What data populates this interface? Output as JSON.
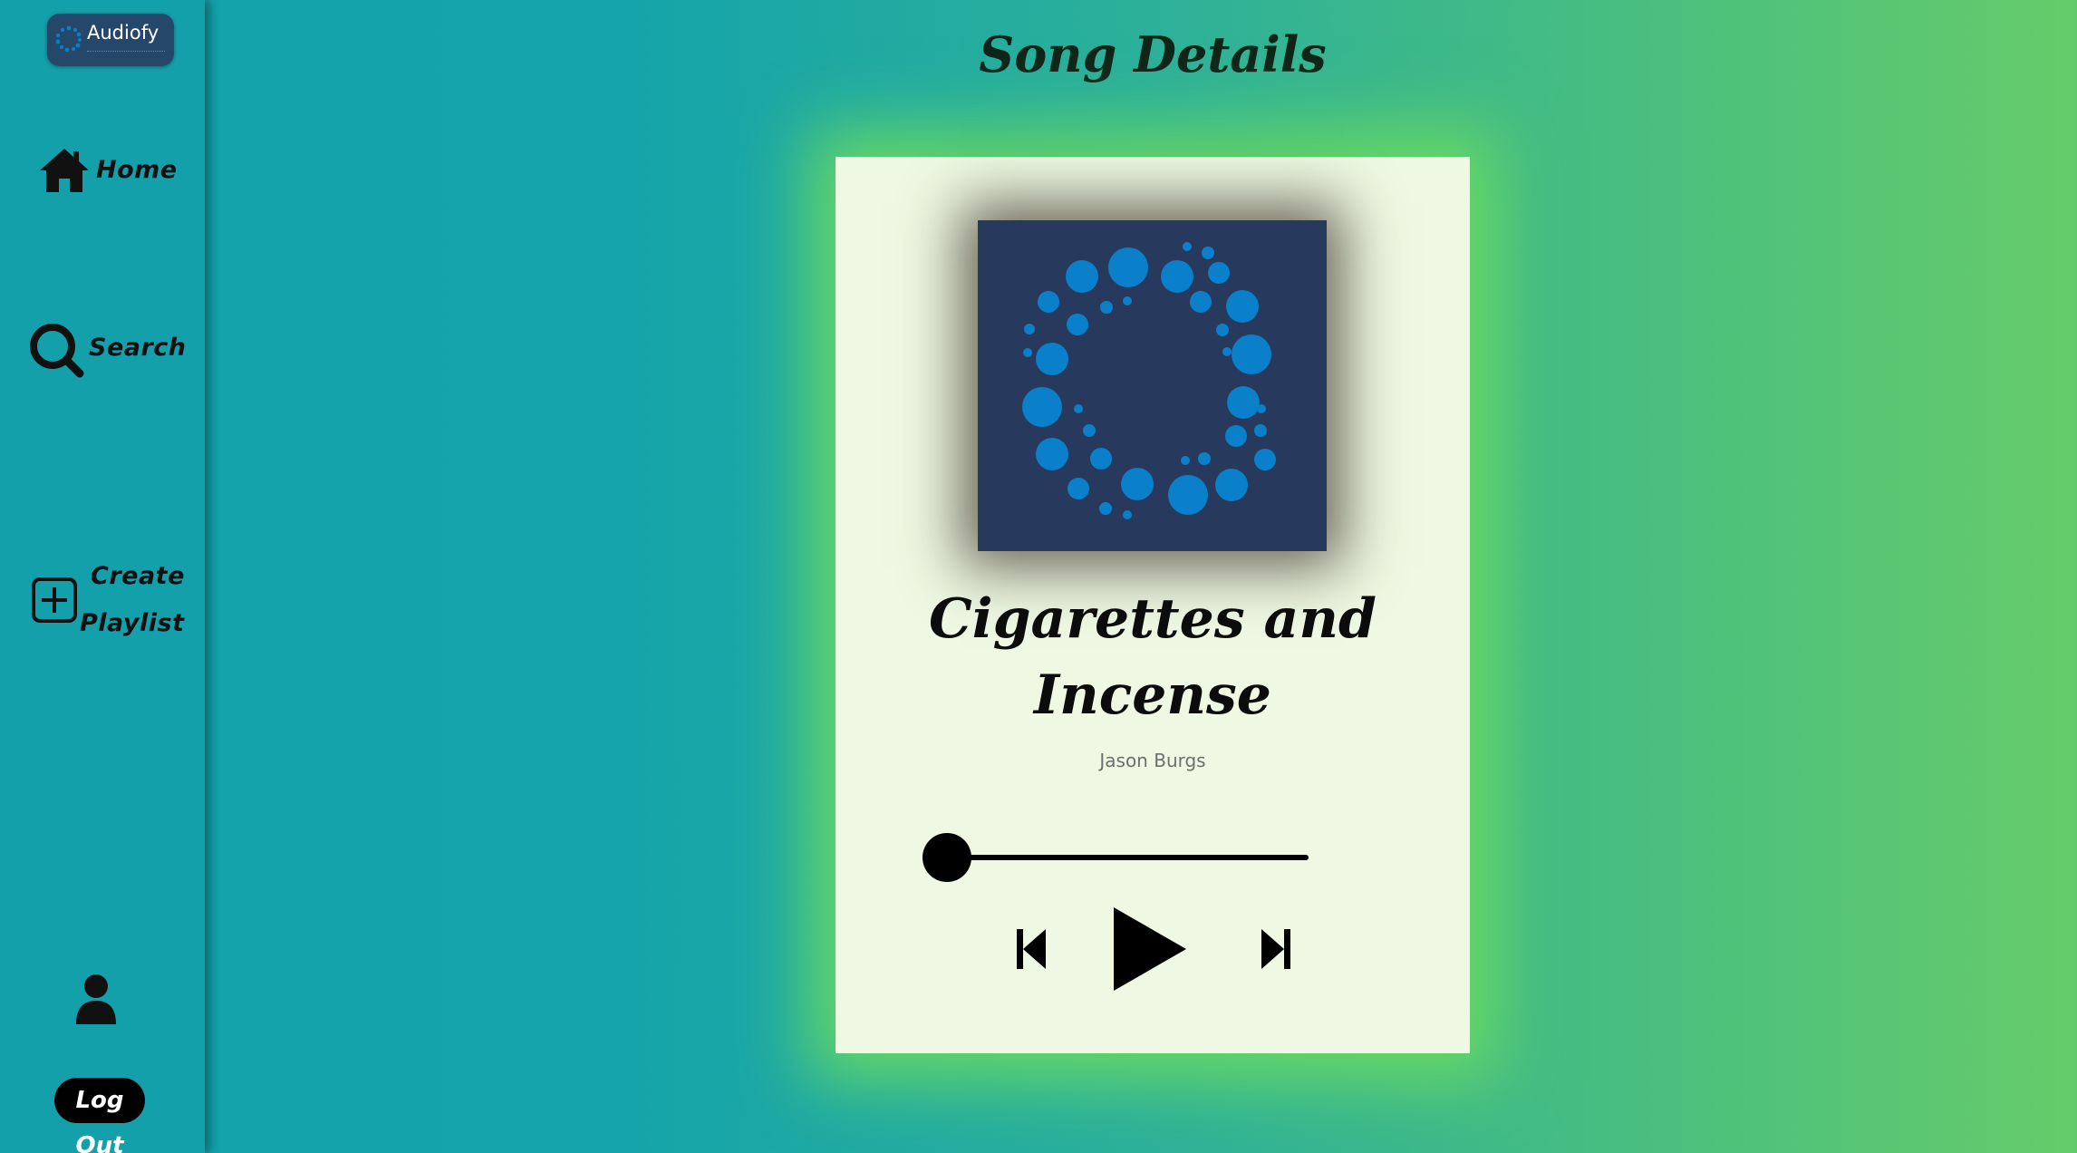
{
  "app": {
    "name": "Audiofy"
  },
  "sidebar": {
    "items": [
      {
        "label": "Home",
        "icon": "home-icon"
      },
      {
        "label": "Search",
        "icon": "search-icon"
      },
      {
        "label_line1": "Create",
        "label_line2": "Playlist",
        "icon": "plus-square-icon"
      }
    ],
    "profile_icon": "user-icon",
    "logout_label": "Log Out"
  },
  "main": {
    "title": "Song Details"
  },
  "song": {
    "title_line1": "Cigarettes and",
    "title_line2": "Incense",
    "artist": "Jason Burgs",
    "progress": 0.0
  },
  "player": {
    "prev_icon": "skip-previous-icon",
    "play_icon": "play-icon",
    "next_icon": "skip-next-icon"
  },
  "colors": {
    "sidebar_bg": "#14a0ab",
    "card_bg": "#eef8e2",
    "card_glow": "#6fdd5f",
    "cover_bg": "#273a5d",
    "cover_dots": "#0a7fca"
  }
}
